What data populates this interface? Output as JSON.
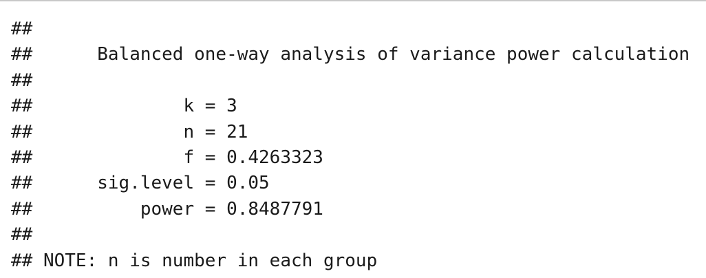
{
  "output": {
    "prefix": "##",
    "lines": [
      "",
      "      Balanced one-way analysis of variance power calculation",
      "",
      "              k = 3",
      "              n = 21",
      "              f = 0.4263323",
      "      sig.level = 0.05",
      "          power = 0.8487791",
      "",
      " NOTE: n is number in each group"
    ]
  }
}
